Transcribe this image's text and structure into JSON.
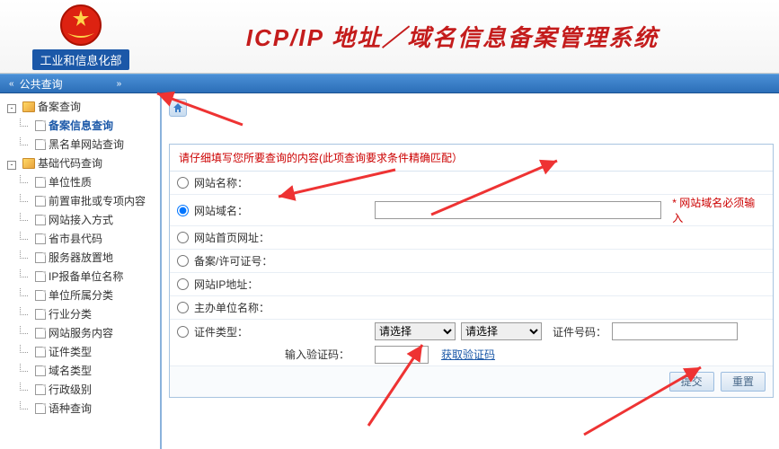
{
  "header": {
    "ministry": "工业和信息化部",
    "title": "ICP/IP 地址／域名信息备案管理系统"
  },
  "navbar": {
    "title": "公共查询"
  },
  "sidebar": {
    "group1": {
      "label": "备案查询"
    },
    "group1_items": [
      {
        "label": "备案信息查询",
        "selected": true
      },
      {
        "label": "黑名单网站查询"
      }
    ],
    "group2": {
      "label": "基础代码查询"
    },
    "group2_items": [
      {
        "label": "单位性质"
      },
      {
        "label": "前置审批或专项内容"
      },
      {
        "label": "网站接入方式"
      },
      {
        "label": "省市县代码"
      },
      {
        "label": "服务器放置地"
      },
      {
        "label": "IP报备单位名称"
      },
      {
        "label": "单位所属分类"
      },
      {
        "label": "行业分类"
      },
      {
        "label": "网站服务内容"
      },
      {
        "label": "证件类型"
      },
      {
        "label": "域名类型"
      },
      {
        "label": "行政级别"
      },
      {
        "label": "语种查询"
      }
    ]
  },
  "form": {
    "instruction": "请仔细填写您所要查询的内容(此项查询要求条件精确匹配）",
    "rows": [
      {
        "name": "site-name",
        "label": "网站名称："
      },
      {
        "name": "site-domain",
        "label": "网站域名：",
        "checked": true,
        "hint": "* 网站域名必须输入"
      },
      {
        "name": "homepage-url",
        "label": "网站首页网址："
      },
      {
        "name": "license-no",
        "label": "备案/许可证号："
      },
      {
        "name": "site-ip",
        "label": "网站IP地址："
      },
      {
        "name": "sponsor-name",
        "label": "主办单位名称："
      },
      {
        "name": "id-type",
        "label": "证件类型："
      }
    ],
    "select_placeholder": "请选择",
    "id_number_label": "证件号码：",
    "captcha_label": "输入验证码：",
    "captcha_link": "获取验证码",
    "submit": "提交",
    "reset": "重置"
  }
}
